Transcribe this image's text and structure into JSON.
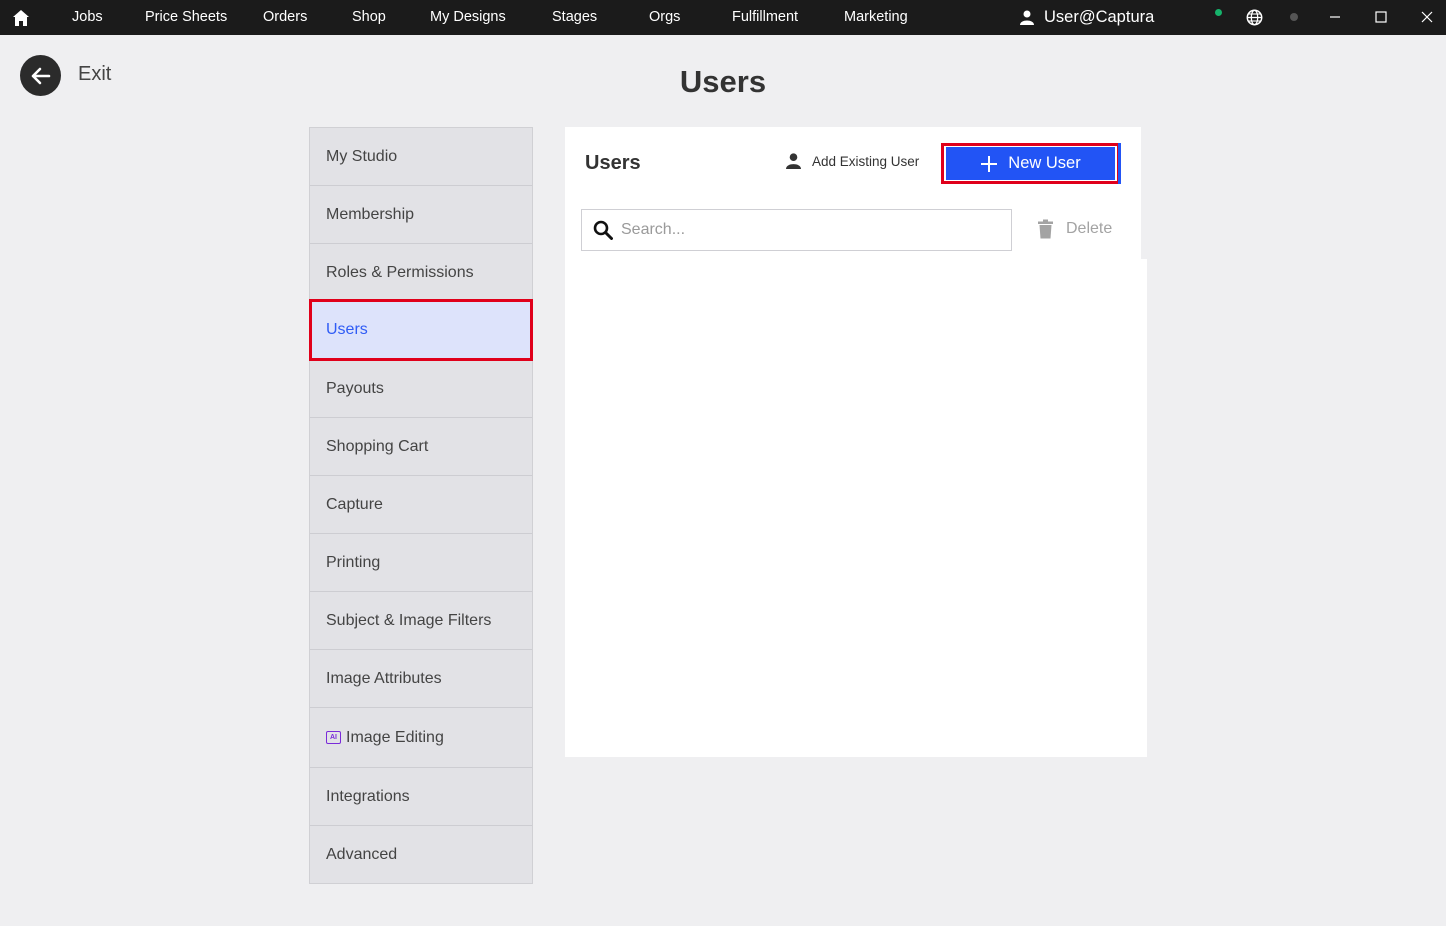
{
  "nav": {
    "items": [
      "Jobs",
      "Price Sheets",
      "Orders",
      "Shop",
      "My Designs",
      "Stages",
      "Orgs",
      "Fulfillment",
      "Marketing"
    ],
    "user": "User@Captura"
  },
  "exit_label": "Exit",
  "page_title": "Users",
  "sidebar": {
    "items": [
      {
        "label": "My Studio"
      },
      {
        "label": "Membership"
      },
      {
        "label": "Roles & Permissions"
      },
      {
        "label": "Users"
      },
      {
        "label": "Payouts"
      },
      {
        "label": "Shopping Cart"
      },
      {
        "label": "Capture"
      },
      {
        "label": "Printing"
      },
      {
        "label": "Subject & Image Filters"
      },
      {
        "label": "Image Attributes"
      },
      {
        "label": "Image Editing",
        "badge": "AI"
      },
      {
        "label": "Integrations"
      },
      {
        "label": "Advanced"
      }
    ]
  },
  "panel": {
    "title": "Users",
    "add_existing_label": "Add Existing User",
    "new_user_label": "New User",
    "search_placeholder": "Search...",
    "delete_label": "Delete"
  },
  "colors": {
    "accent": "#2254f5",
    "highlight": "#e0001b",
    "active_bg": "#dde3fb",
    "status": "#16b36b"
  }
}
